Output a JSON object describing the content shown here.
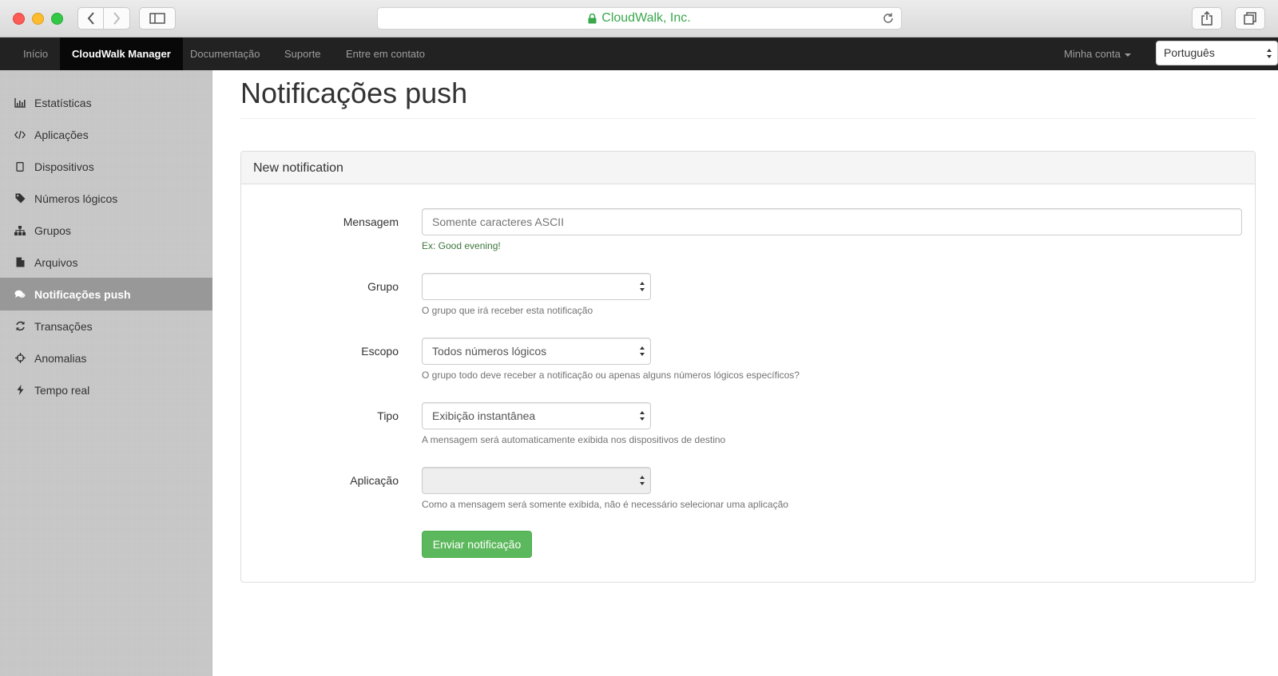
{
  "browser": {
    "url_title": "CloudWalk, Inc."
  },
  "navbar": {
    "items": [
      {
        "label": "Início",
        "active": false
      },
      {
        "label": "CloudWalk Manager",
        "active": true
      },
      {
        "label": "Documentação",
        "active": false
      },
      {
        "label": "Suporte",
        "active": false
      },
      {
        "label": "Entre em contato",
        "active": false
      }
    ],
    "account_label": "Minha conta",
    "language_selected": "Português"
  },
  "sidebar": {
    "items": [
      {
        "label": "Estatísticas",
        "icon": "bar-chart-icon"
      },
      {
        "label": "Aplicações",
        "icon": "code-icon"
      },
      {
        "label": "Dispositivos",
        "icon": "device-icon"
      },
      {
        "label": "Números lógicos",
        "icon": "tag-icon"
      },
      {
        "label": "Grupos",
        "icon": "sitemap-icon"
      },
      {
        "label": "Arquivos",
        "icon": "file-icon"
      },
      {
        "label": "Notificações push",
        "icon": "comments-icon",
        "active": true
      },
      {
        "label": "Transações",
        "icon": "refresh-icon"
      },
      {
        "label": "Anomalias",
        "icon": "crosshairs-icon"
      },
      {
        "label": "Tempo real",
        "icon": "bolt-icon"
      }
    ]
  },
  "main": {
    "title": "Notificações push",
    "panel_heading": "New notification",
    "form": {
      "mensagem": {
        "label": "Mensagem",
        "placeholder": "Somente caracteres ASCII",
        "value": "",
        "help": "Ex: Good evening!"
      },
      "grupo": {
        "label": "Grupo",
        "value": "",
        "help": "O grupo que irá receber esta notificação"
      },
      "escopo": {
        "label": "Escopo",
        "value": "Todos números lógicos",
        "help": "O grupo todo deve receber a notificação ou apenas alguns números lógicos específicos?"
      },
      "tipo": {
        "label": "Tipo",
        "value": "Exibição instantânea",
        "help": "A mensagem será automaticamente exibida nos dispositivos de destino"
      },
      "aplicacao": {
        "label": "Aplicação",
        "value": "",
        "disabled": true,
        "help": "Como a mensagem será somente exibida, não é necessário selecionar uma aplicação"
      },
      "submit_label": "Enviar notificação"
    }
  },
  "colors": {
    "navbar_bg": "#222222",
    "active_nav_bg": "#080808",
    "sidebar_bg": "#c9c9c9",
    "sidebar_active_bg": "#989898",
    "submit_bg": "#5cb85c",
    "url_green": "#39a84b"
  }
}
